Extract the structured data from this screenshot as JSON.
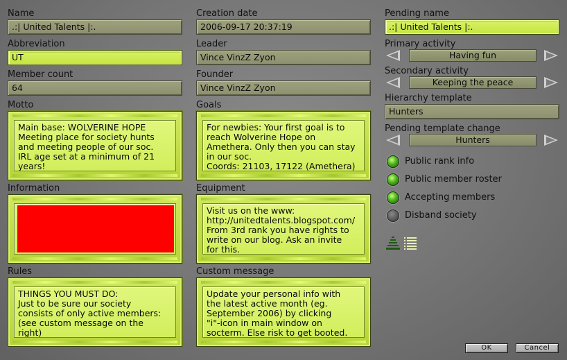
{
  "labels": {
    "name": "Name",
    "abbreviation": "Abbreviation",
    "member_count": "Member count",
    "motto": "Motto",
    "information": "Information",
    "rules": "Rules",
    "creation_date": "Creation date",
    "leader": "Leader",
    "founder": "Founder",
    "goals": "Goals",
    "equipment": "Equipment",
    "custom_message": "Custom message",
    "pending_name": "Pending name",
    "primary_activity": "Primary activity",
    "secondary_activity": "Secondary activity",
    "hierarchy_template": "Hierarchy template",
    "pending_template_change": "Pending template change"
  },
  "values": {
    "name": ".:| United Talents |:.",
    "abbreviation": "UT",
    "member_count": "64",
    "creation_date": "2006-09-17 20:37:19",
    "leader": "Vince VinzZ Zyon",
    "founder": "Vince VinzZ Zyon",
    "pending_name": ".:| United Talents |:.",
    "primary_activity": "Having fun",
    "secondary_activity": "Keeping the peace",
    "hierarchy_template": "Hunters",
    "pending_template_change": "Hunters"
  },
  "texts": {
    "motto": [
      "Main base: WOLVERINE HOPE",
      "Meeting place for society hunts",
      "and meeting people of our soc.",
      "IRL age set at a minimum of 21",
      "years!"
    ],
    "goals": [
      "For newbies: Your first goal is to",
      "reach Wolverine Hope on",
      "Amethera. Only then you can stay",
      "in our soc.",
      "Coords: 21103, 17122 (Amethera)"
    ],
    "equipment": [
      "Visit us on the www:",
      "http://unitedtalents.blogspot.com/",
      "From 3rd rank you have rights to",
      "write on our blog. Ask an invite",
      "for this."
    ],
    "rules": [
      "THINGS YOU MUST DO:",
      "Just to be sure our society",
      "consists of only active members:",
      "(see custom message on the",
      "right)"
    ],
    "custom_message": [
      "Update your personal info with",
      "the latest active month (eg.",
      "September 2006) by clicking",
      "\"i\"-icon in main window on",
      "socterm. Else risk to get booted."
    ]
  },
  "options": [
    {
      "label": "Public rank info",
      "enabled": true
    },
    {
      "label": "Public member roster",
      "enabled": true
    },
    {
      "label": "Accepting members",
      "enabled": true
    },
    {
      "label": "Disband society",
      "enabled": false
    }
  ],
  "buttons": {
    "ok": "OK",
    "cancel": "Cancel"
  },
  "colors": {
    "accent_green": "#c4e43d",
    "information_block": "#ff0000"
  },
  "icons": [
    "hierarchy-tree-icon",
    "member-list-icon",
    "left-arrow-icon",
    "right-arrow-icon"
  ]
}
